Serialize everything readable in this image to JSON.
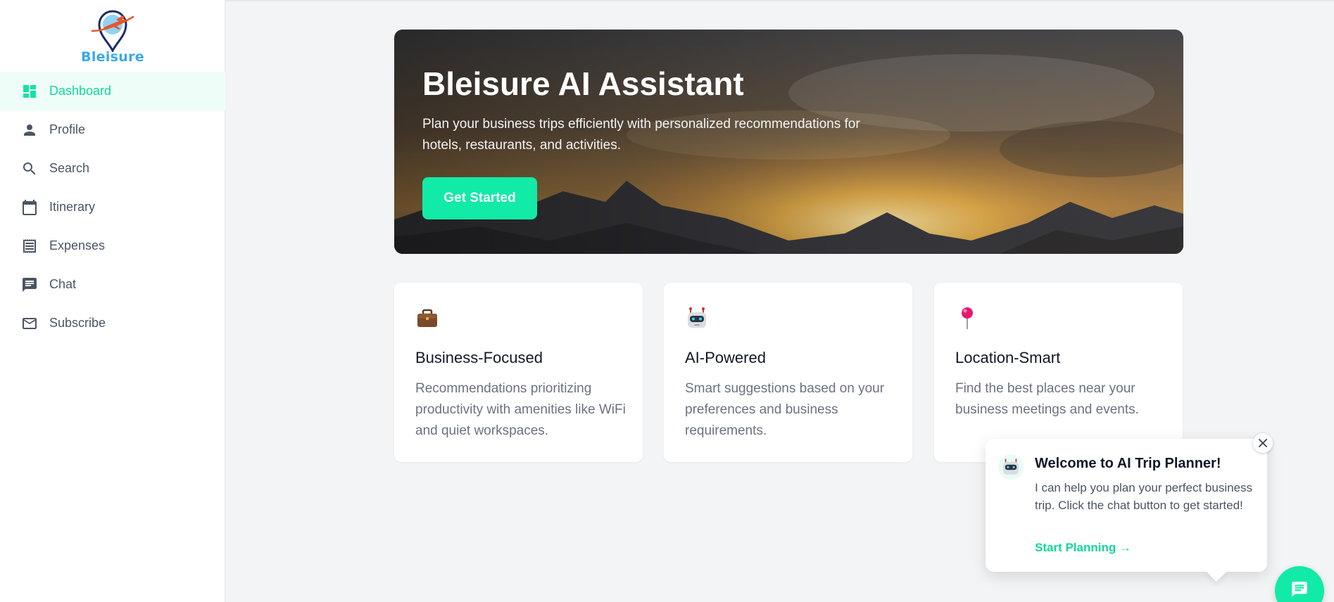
{
  "app": {
    "logo_text": "Bleisure"
  },
  "sidebar": {
    "items": [
      {
        "label": "Dashboard",
        "icon": "dashboard-icon",
        "active": true
      },
      {
        "label": "Profile",
        "icon": "person-icon"
      },
      {
        "label": "Search",
        "icon": "search-icon"
      },
      {
        "label": "Itinerary",
        "icon": "calendar-icon"
      },
      {
        "label": "Expenses",
        "icon": "receipt-icon"
      },
      {
        "label": "Chat",
        "icon": "chat-icon"
      },
      {
        "label": "Subscribe",
        "icon": "mail-icon"
      }
    ]
  },
  "hero": {
    "title": "Bleisure AI Assistant",
    "subtitle": "Plan your business trips efficiently with personalized recommendations for hotels, restaurants, and activities.",
    "cta_label": "Get Started"
  },
  "features": [
    {
      "icon": "briefcase-icon",
      "title": "Business-Focused",
      "desc": "Recommendations prioritizing productivity with amenities like WiFi and quiet workspaces."
    },
    {
      "icon": "robot-icon",
      "title": "AI-Powered",
      "desc": "Smart suggestions based on your preferences and business requirements."
    },
    {
      "icon": "pushpin-icon",
      "title": "Location-Smart",
      "desc": "Find the best places near your business meetings and events."
    }
  ],
  "popup": {
    "title": "Welcome to AI Trip Planner!",
    "text": "I can help you plan your perfect business trip. Click the chat button to get started!",
    "link_label": "Start Planning →"
  },
  "colors": {
    "accent": "#12eaa8",
    "accent_text": "#10d89c",
    "logo": "#38a9e8",
    "sidebar_active_bg": "#effdf8"
  }
}
